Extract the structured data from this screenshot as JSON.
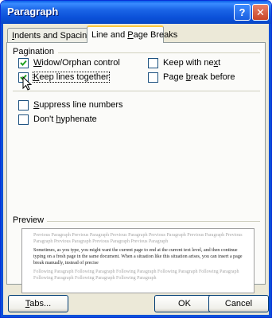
{
  "window": {
    "title": "Paragraph",
    "help_glyph": "?",
    "close_glyph": "✕",
    "accent_color": "#0a50d8",
    "tab_highlight_color": "#ffc83c"
  },
  "tabs": [
    {
      "label": "Indents and Spacing",
      "underline": "I",
      "rest": "ndents and Spacing",
      "active": false
    },
    {
      "label": "Line and Page Breaks",
      "underline": "P",
      "pre": "Line and ",
      "rest": "age Breaks",
      "active": true
    }
  ],
  "pagination": {
    "label": "Pagination",
    "options": [
      {
        "label": "Widow/Orphan control",
        "underline": "W",
        "rest": "idow/Orphan control",
        "checked": true
      },
      {
        "label": "Keep lines together",
        "underline": "K",
        "rest": "eep lines together",
        "checked": true,
        "focused": true
      },
      {
        "label": "Keep with next",
        "pre": "Keep with ne",
        "underline": "x",
        "rest": "t",
        "checked": false
      },
      {
        "label": "Page break before",
        "pre": "Page ",
        "underline": "b",
        "rest": "reak before",
        "checked": false
      }
    ]
  },
  "other_options": [
    {
      "label": "Suppress line numbers",
      "underline": "S",
      "rest": "uppress line numbers",
      "checked": false
    },
    {
      "label": "Don't hyphenate",
      "pre": "Don't ",
      "underline": "h",
      "rest": "yphenate",
      "checked": false
    }
  ],
  "preview": {
    "label": "Preview",
    "previous_text": "Previous Paragraph Previous Paragraph Previous Paragraph Previous Paragraph Previous Paragraph Previous Paragraph Previous Paragraph Previous Paragraph Previous Paragraph",
    "main_text": "Sometimes, as you type, you might want the current page to end at the current text level, and then continue typing on a fresh page in the same document. When a situation like this situation arises, you can insert a page break manually, instead of precise",
    "following_text": "Following Paragraph Following Paragraph Following Paragraph Following Paragraph Following Paragraph Following Paragraph Following Paragraph Following Paragraph"
  },
  "buttons": {
    "tabs": {
      "label": "Tabs...",
      "underline": "T",
      "rest": "abs..."
    },
    "ok": "OK",
    "cancel": "Cancel"
  }
}
